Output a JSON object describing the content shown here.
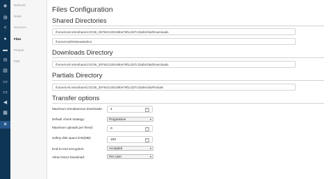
{
  "sidebar": {
    "icons": [
      {
        "name": "app-logo-icon",
        "glyph": "❖"
      },
      {
        "name": "globe-icon",
        "glyph": "◍"
      },
      {
        "name": "share-icon",
        "glyph": "<"
      },
      {
        "name": "users-icon",
        "glyph": "●"
      },
      {
        "name": "chat-icon",
        "glyph": "▬"
      },
      {
        "name": "mail-icon",
        "glyph": "✉"
      },
      {
        "name": "forum-icon",
        "glyph": "▤"
      },
      {
        "name": "channels-icon",
        "glyph": "▭"
      },
      {
        "name": "monitor-icon",
        "glyph": "▭"
      },
      {
        "name": "megaphone-icon",
        "glyph": "◀"
      },
      {
        "name": "tasks-icon",
        "glyph": "▦"
      },
      {
        "name": "settings-icon",
        "glyph": "⚙"
      },
      {
        "name": "network-config-icon",
        "glyph": "✕"
      }
    ],
    "menu": [
      "Network",
      "Node",
      "Services",
      "Files",
      "People",
      "Mail"
    ]
  },
  "page": {
    "title": "Files Configuration",
    "shared_heading": "Shared Directories",
    "shared_dirs": [
      "/home/ceit.retroshare/LOC06_3979c0130106be79f1cd37c33afecfa5/Downloads",
      "/home/ceit/RSNewWebUI"
    ],
    "downloads_heading": "Downloads Directory",
    "downloads_dir": "/home/ceit.retroshare/LOC06_3979c0130106be79f1cd37c33afecfa5/Downloads",
    "partials_heading": "Partials Directory",
    "partials_dir": "/home/ceit.retroshare/LOC06_3979c0130106be79f1cd37c33afecfa5/Partials",
    "transfer_heading": "Transfer options",
    "options": {
      "max_downloads_label": "Maximum simultaneous downloads:",
      "max_downloads_value": "4",
      "chunk_strategy_label": "Default chunk strategy:",
      "chunk_strategy_value": "Progressive",
      "max_uploads_label": "Maximum uploads per friend:",
      "max_uploads_value": "0",
      "disk_limit_label": "Safety disk space limit(MB):",
      "disk_limit_value": "100",
      "encryption_label": "End-to-end encryption:",
      "encryption_value": "Accepted",
      "direct_download_label": "Allow Direct Download:",
      "direct_download_value": "Per User"
    }
  }
}
